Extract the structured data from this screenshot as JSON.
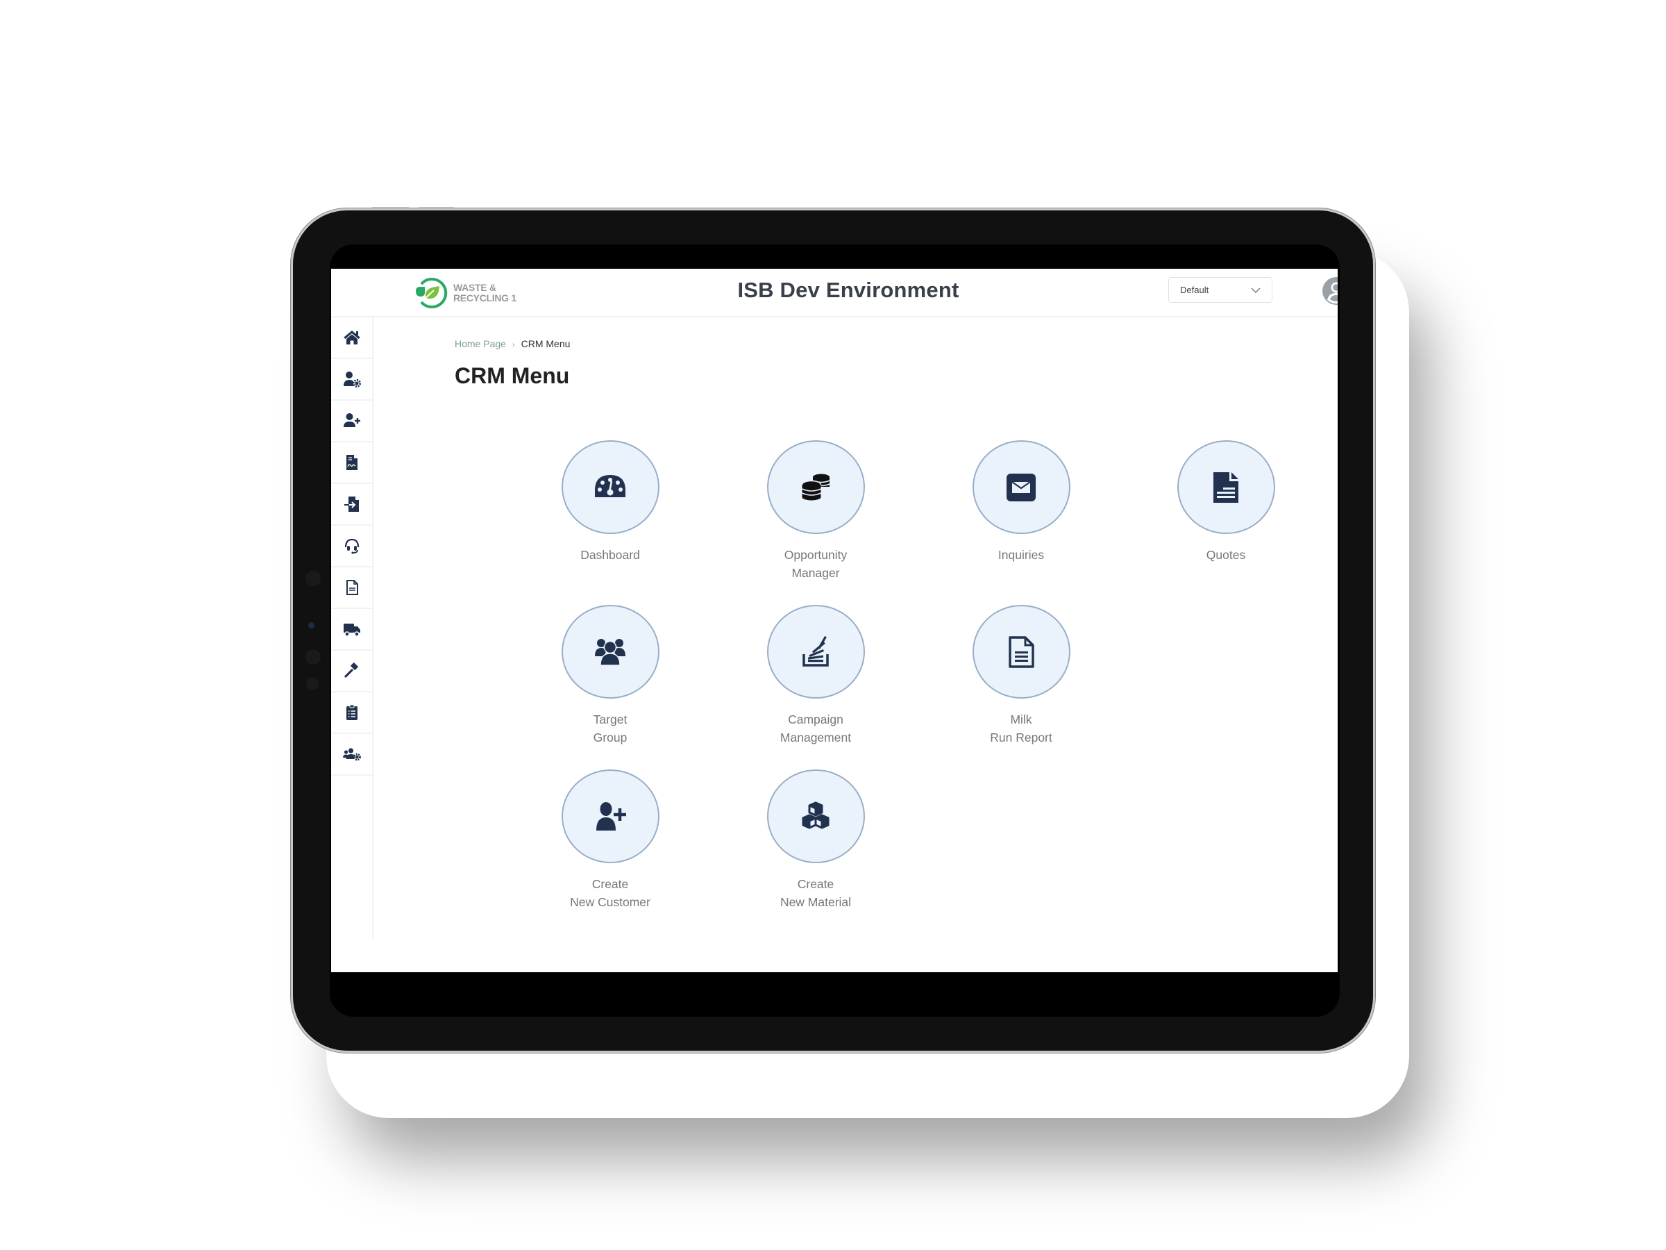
{
  "header": {
    "logo_line1": "WASTE &",
    "logo_line2": "RECYCLING 1",
    "title": "ISB Dev Environment",
    "environment_select": {
      "selected": "Default"
    },
    "avatar_icon": "user-circle-icon"
  },
  "sidebar": {
    "items": [
      {
        "id": "home",
        "icon": "home-icon"
      },
      {
        "id": "user-settings",
        "icon": "user-gear-icon"
      },
      {
        "id": "add-user",
        "icon": "user-plus-icon"
      },
      {
        "id": "signed-document",
        "icon": "file-signature-icon"
      },
      {
        "id": "file-import",
        "icon": "file-import-icon"
      },
      {
        "id": "support",
        "icon": "headset-icon"
      },
      {
        "id": "document",
        "icon": "file-lines-icon"
      },
      {
        "id": "delivery",
        "icon": "truck-icon"
      },
      {
        "id": "auction",
        "icon": "gavel-icon"
      },
      {
        "id": "checklist",
        "icon": "clipboard-list-icon"
      },
      {
        "id": "group-settings",
        "icon": "users-gear-icon"
      }
    ]
  },
  "breadcrumb": {
    "home": "Home Page",
    "separator": "›",
    "current": "CRM Menu"
  },
  "page": {
    "title": "CRM Menu"
  },
  "tiles": [
    {
      "id": "dashboard",
      "line1": "Dashboard",
      "line2": "",
      "icon": "gauge-icon"
    },
    {
      "id": "opportunity-manager",
      "line1": "Opportunity",
      "line2": "Manager",
      "icon": "coins-icon"
    },
    {
      "id": "inquiries",
      "line1": "Inquiries",
      "line2": "",
      "icon": "envelope-square-icon"
    },
    {
      "id": "quotes",
      "line1": "Quotes",
      "line2": "",
      "icon": "file-text-icon"
    },
    {
      "id": "target-group",
      "line1": "Target",
      "line2": "Group",
      "icon": "users-icon"
    },
    {
      "id": "campaign-management",
      "line1": "Campaign",
      "line2": "Management",
      "icon": "stack-overflow-icon"
    },
    {
      "id": "milk-run-report",
      "line1": "Milk",
      "line2": "Run Report",
      "icon": "file-outline-icon"
    },
    {
      "id": "create-new-customer",
      "line1": "Create",
      "line2": "New Customer",
      "icon": "user-plus-icon"
    },
    {
      "id": "create-new-material",
      "line1": "Create",
      "line2": "New Material",
      "icon": "cubes-icon"
    }
  ],
  "colors": {
    "icon_navy": "#22324e",
    "tile_fill": "#eaf3fc",
    "tile_border": "#98aec7",
    "logo_green_dark": "#2aa866",
    "logo_green_light": "#7cc23c"
  }
}
